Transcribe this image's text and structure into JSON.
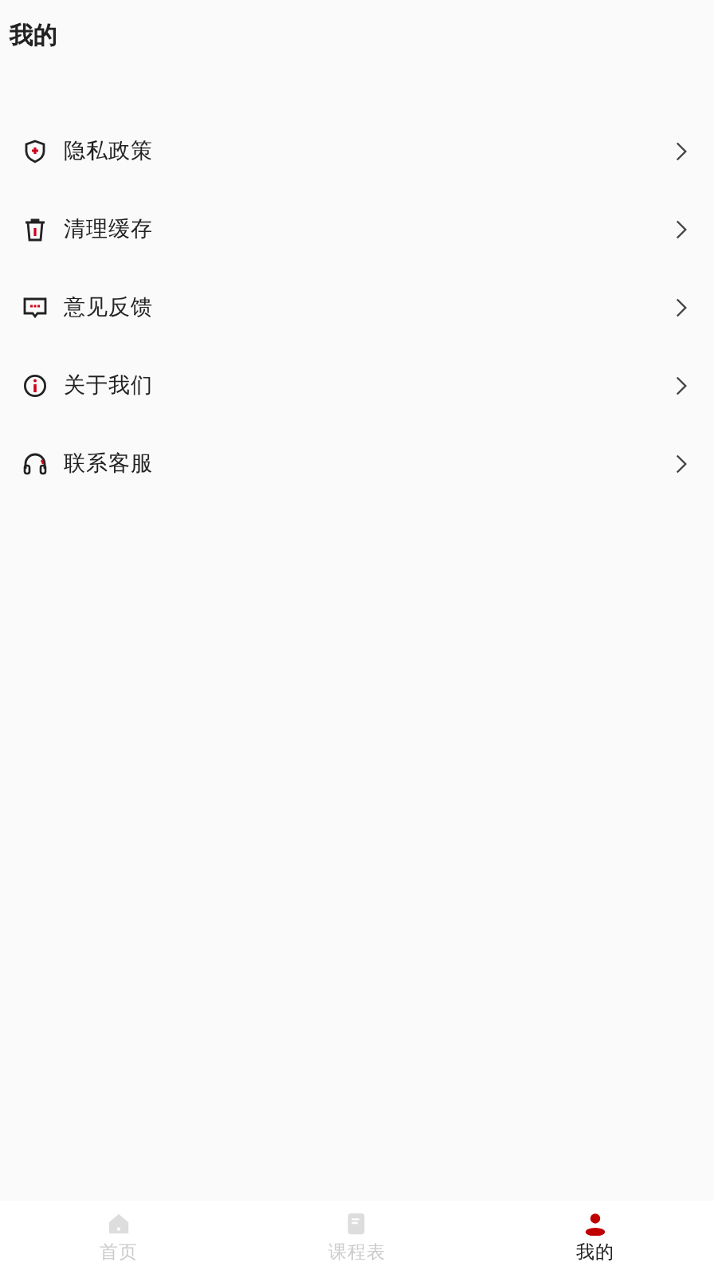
{
  "header": {
    "title": "我的"
  },
  "menu": [
    {
      "kind": "shield",
      "label": "隐私政策"
    },
    {
      "kind": "trash",
      "label": "清理缓存"
    },
    {
      "kind": "message",
      "label": "意见反馈"
    },
    {
      "kind": "info",
      "label": "关于我们"
    },
    {
      "kind": "headset",
      "label": "联系客服"
    }
  ],
  "tab_bar": [
    {
      "kind": "home",
      "label": "首页",
      "selected": false
    },
    {
      "kind": "book",
      "label": "课程表",
      "selected": false
    },
    {
      "kind": "person",
      "label": "我的",
      "selected": true
    }
  ]
}
